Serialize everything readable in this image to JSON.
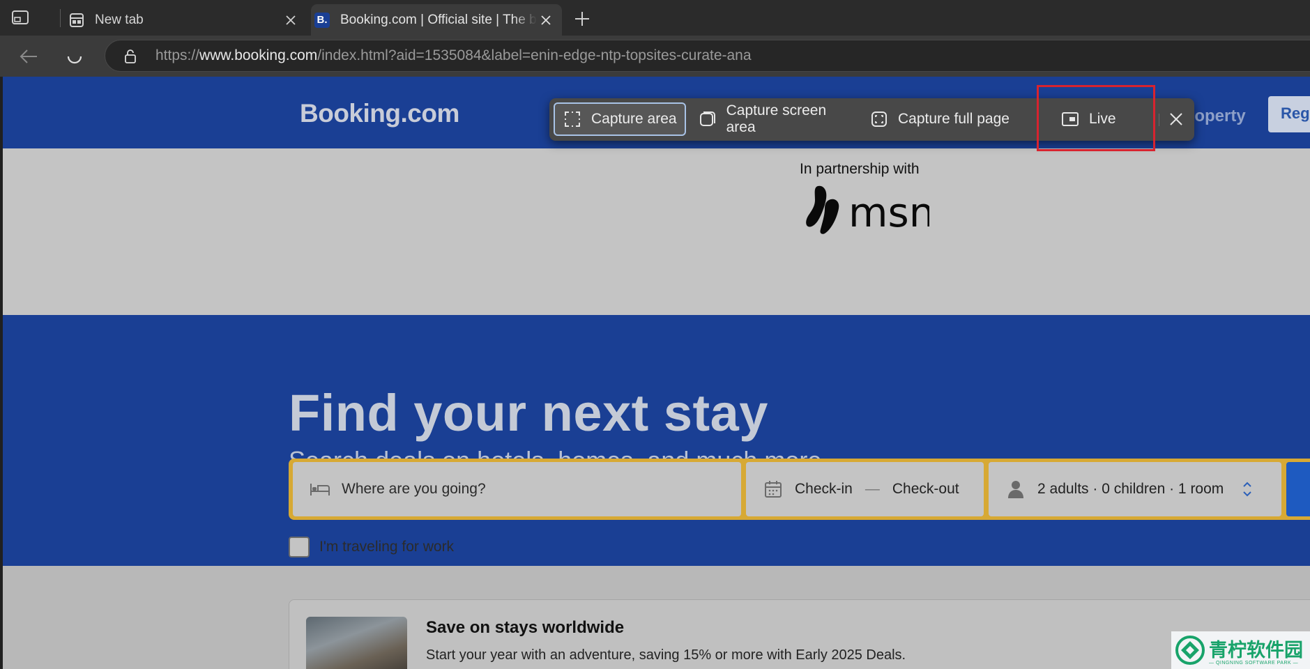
{
  "browser": {
    "tabs": [
      {
        "title": "New tab",
        "active": false
      },
      {
        "title": "Booking.com | Official site | The best hotels, flights, car rentals & accommodations",
        "active": true,
        "favicon_letter": "B."
      }
    ],
    "url_prefix": "https://",
    "url_host": "www.booking.com",
    "url_path": "/index.html?aid=1535084&label=enin-edge-ntp-topsites-curate-ana"
  },
  "capture_toolbar": {
    "capture_area": "Capture area",
    "capture_screen_area": "Capture screen area",
    "capture_full_page": "Capture full page",
    "live": "Live"
  },
  "site": {
    "logo": "Booking.com",
    "list_property": "roperty",
    "register": "Regi",
    "partnership_text": "In partnership with",
    "partner_name": "msn",
    "hero_title": "Find your next stay",
    "hero_subtitle": "Search deals on hotels, homes, and much more...",
    "search": {
      "destination_placeholder": "Where are you going?",
      "check_in": "Check-in",
      "dash": "—",
      "check_out": "Check-out",
      "occupancy": "2 adults · 0 children · 1 room"
    },
    "work_travel": "I'm traveling for work",
    "promo": {
      "title": "Save on stays worldwide",
      "subtitle": "Start your year with an adventure, saving 15% or more with Early 2025 Deals."
    }
  },
  "watermark": {
    "main": "青柠软件园",
    "sub": "— QINGNING SOFTWARE PARK —"
  },
  "colors": {
    "booking_blue": "#1a3f94",
    "search_border": "#d7a934",
    "highlight_red": "#d8232f"
  }
}
